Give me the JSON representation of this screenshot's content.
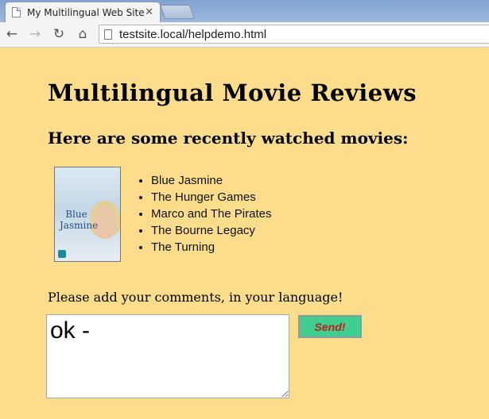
{
  "browser": {
    "tab_title": "My Multilingual Web Site",
    "tab_close_icon": "close-icon",
    "url": "testsite.local/helpdemo.html"
  },
  "page": {
    "heading": "Multilingual Movie Reviews",
    "subheading": "Here are some recently watched movies:",
    "poster_title": "Blue Jasmine",
    "movies": [
      "Blue Jasmine",
      "The Hunger Games",
      "Marco and The Pirates",
      "The Bourne Legacy",
      "The Turning"
    ],
    "comment_prompt": "Please add your comments, in your language!",
    "comment_value": "ok -",
    "send_label": "Send!"
  },
  "colors": {
    "page_background": "#fbdd8c",
    "send_button_bg": "#3ecf8f",
    "send_button_text": "#c21d1d"
  }
}
